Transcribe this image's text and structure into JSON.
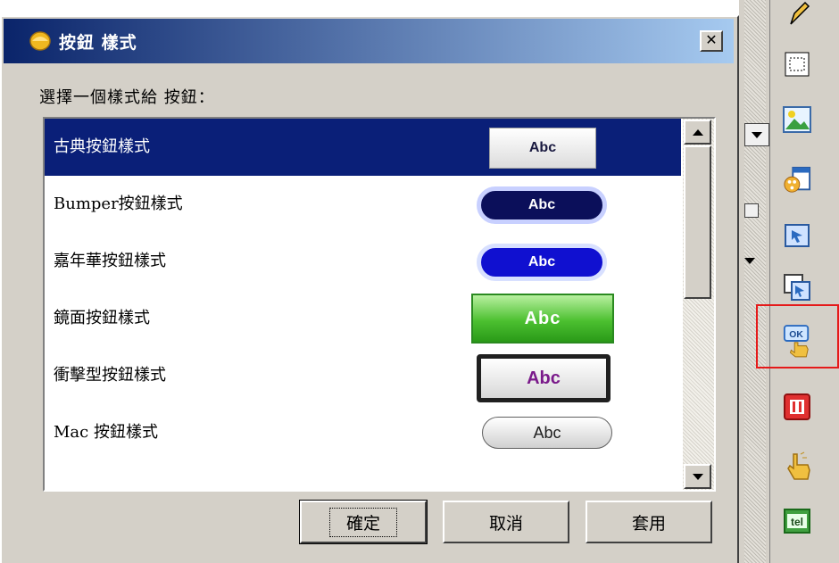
{
  "dialog": {
    "title": "按鈕 樣式",
    "close_glyph": "✕",
    "prompt": "選擇一個樣式給 按鈕：",
    "styles": [
      {
        "label": "古典按鈕樣式",
        "preview": "Abc",
        "selected": true
      },
      {
        "label": "Bumper按鈕樣式",
        "preview": "Abc",
        "selected": false
      },
      {
        "label": "嘉年華按鈕樣式",
        "preview": "Abc",
        "selected": false
      },
      {
        "label": "鏡面按鈕樣式",
        "preview": "Abc",
        "selected": false
      },
      {
        "label": "衝擊型按鈕樣式",
        "preview": "Abc",
        "selected": false
      },
      {
        "label": "Mac 按鈕樣式",
        "preview": "Abc",
        "selected": false
      }
    ],
    "buttons": {
      "ok": "確定",
      "cancel": "取消",
      "apply": "套用"
    }
  },
  "toolbar": {
    "icons": [
      "pencil-icon",
      "rectangle-select-icon",
      "image-icon",
      "media-file-icon",
      "hyperlink-icon",
      "overlay-icon",
      "ok-button-icon",
      "pause-button-icon",
      "hotspot-hand-icon",
      "text-field-icon"
    ],
    "highlighted_icon": "ok-button-icon",
    "ok_icon_text": "OK",
    "text_icon_text": "tel"
  },
  "colors": {
    "selection": "#0a1f78",
    "title_start": "#0a246a",
    "title_end": "#a6caf0",
    "highlight": "#e51a1a"
  }
}
